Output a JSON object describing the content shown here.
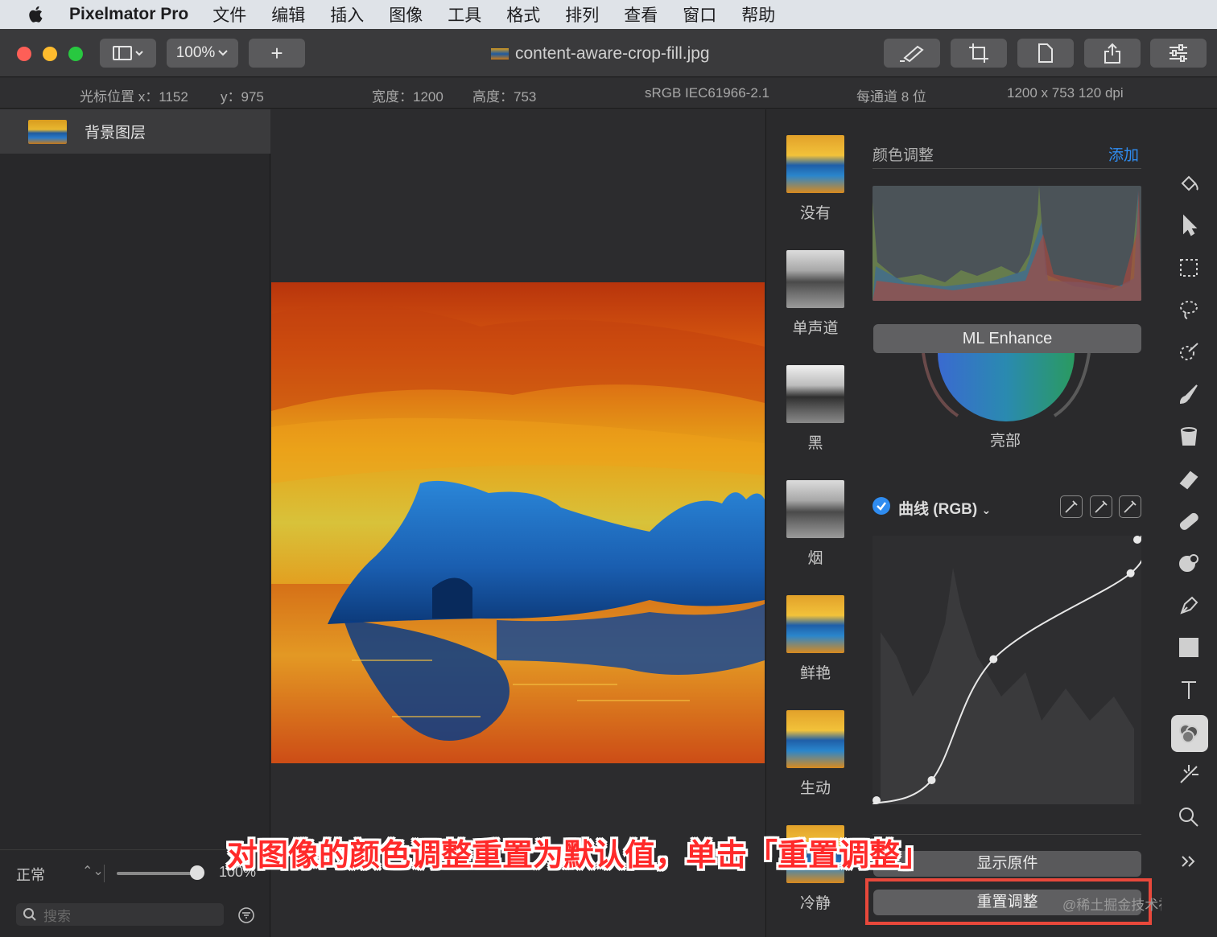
{
  "menubar": {
    "app_name": "Pixelmator Pro",
    "items": [
      "文件",
      "编辑",
      "插入",
      "图像",
      "工具",
      "格式",
      "排列",
      "查看",
      "窗口",
      "帮助"
    ]
  },
  "toolbar": {
    "zoom": "100%",
    "add_label": "+",
    "document_title": "content-aware-crop-fill.jpg"
  },
  "infobar": {
    "cursor_x": "光标位置 x：1152",
    "cursor_y": "y：975",
    "width": "宽度：1200",
    "height": "高度：753",
    "color_profile": "sRGB IEC61966-2.1",
    "bit_depth": "每通道 8 位",
    "dimensions": "1200 x 753 120 dpi"
  },
  "layers": {
    "items": [
      {
        "name": "背景图层"
      }
    ],
    "blend_mode": "正常",
    "opacity": "100%",
    "opacity_value": 1.0,
    "search_placeholder": "搜索"
  },
  "presets": [
    {
      "label": "没有",
      "style": "color"
    },
    {
      "label": "单声道",
      "style": "gray"
    },
    {
      "label": "黑",
      "style": "dark"
    },
    {
      "label": "烟",
      "style": "gray"
    },
    {
      "label": "鲜艳",
      "style": "color"
    },
    {
      "label": "生动",
      "style": "color"
    },
    {
      "label": "冷静",
      "style": "color"
    }
  ],
  "adjustments": {
    "title": "颜色调整",
    "add_label": "添加",
    "ml_enhance": "ML Enhance",
    "wheel_label": "亮部",
    "curves_title": "曲线 (RGB)",
    "curve_points": [
      [
        0,
        0
      ],
      [
        0.22,
        0.09
      ],
      [
        0.45,
        0.54
      ],
      [
        0.96,
        0.86
      ],
      [
        1,
        1
      ]
    ],
    "show_original": "显示原件",
    "reset": "重置调整"
  },
  "annotation": {
    "callout": "对图像的颜色调整重置为默认值，单击「重置调整」",
    "watermark": "@稀土掘金技术社区"
  },
  "colors": {
    "accent": "#2f8cf0",
    "highlight_box": "#e8483b",
    "callout_text": "#ff2a2a"
  }
}
